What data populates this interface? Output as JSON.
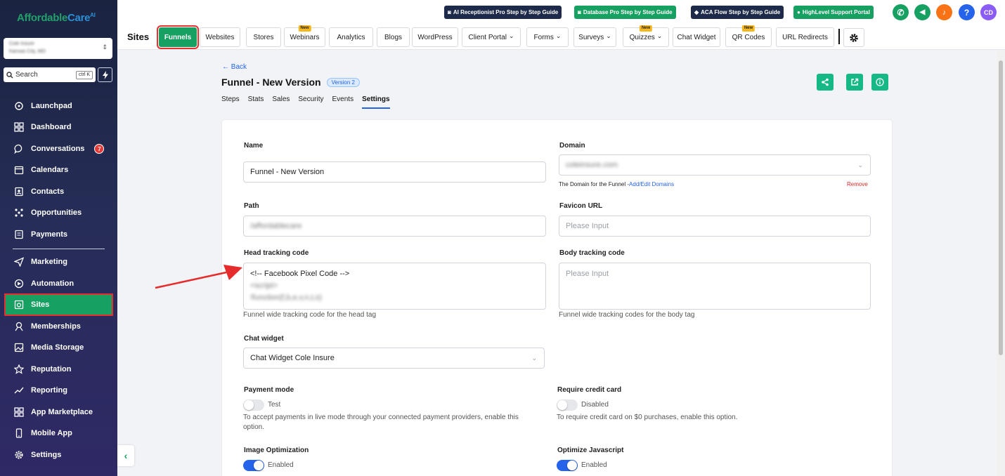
{
  "sidebar": {
    "logo_part1": "Affordable",
    "logo_part2": "Care",
    "logo_part3": "AI",
    "account_name": "Cole Insure",
    "account_location": "Kansas City, MO",
    "search_placeholder": "Search",
    "search_shortcut": "ctrl K",
    "items": [
      {
        "label": "Launchpad",
        "icon": "rocket-icon"
      },
      {
        "label": "Dashboard",
        "icon": "grid-icon"
      },
      {
        "label": "Conversations",
        "icon": "chat-icon",
        "badge": "7"
      },
      {
        "label": "Calendars",
        "icon": "calendar-icon"
      },
      {
        "label": "Contacts",
        "icon": "contacts-icon"
      },
      {
        "label": "Opportunities",
        "icon": "opportunities-icon"
      },
      {
        "label": "Payments",
        "icon": "payments-icon"
      },
      {
        "label": "Marketing",
        "icon": "send-icon"
      },
      {
        "label": "Automation",
        "icon": "automation-icon"
      },
      {
        "label": "Sites",
        "icon": "sites-icon",
        "active": true
      },
      {
        "label": "Memberships",
        "icon": "memberships-icon"
      },
      {
        "label": "Media Storage",
        "icon": "image-icon"
      },
      {
        "label": "Reputation",
        "icon": "star-icon"
      },
      {
        "label": "Reporting",
        "icon": "trend-icon"
      },
      {
        "label": "App Marketplace",
        "icon": "apps-icon"
      },
      {
        "label": "Mobile App",
        "icon": "phone-icon"
      },
      {
        "label": "Settings",
        "icon": "gear-icon"
      }
    ]
  },
  "topbar": {
    "links": [
      "AI Receptionist Pro Step by Step Guide",
      "Database Pro Step by Step Guide",
      "ACA Flow Step by Step Guide",
      "HighLevel Support Portal"
    ],
    "help_label": "?",
    "avatar_initials": "CD"
  },
  "sites_nav": {
    "title": "Sites",
    "tabs": [
      {
        "label": "Funnels",
        "active": true
      },
      {
        "label": "Websites"
      },
      {
        "label": "Stores"
      },
      {
        "label": "Webinars",
        "new": "New"
      },
      {
        "label": "Analytics"
      },
      {
        "label": "Blogs"
      },
      {
        "label": "WordPress"
      },
      {
        "label": "Client Portal",
        "dropdown": true
      },
      {
        "label": "Forms",
        "dropdown": true
      },
      {
        "label": "Surveys",
        "dropdown": true
      },
      {
        "label": "Quizzes",
        "dropdown": true,
        "new": "New"
      },
      {
        "label": "Chat Widget"
      },
      {
        "label": "QR Codes",
        "new": "New"
      },
      {
        "label": "URL Redirects"
      }
    ]
  },
  "funnel": {
    "back_label": "← Back",
    "title": "Funnel - New Version",
    "version_badge": "Version 2",
    "subtabs": [
      "Steps",
      "Stats",
      "Sales",
      "Security",
      "Events",
      "Settings"
    ],
    "active_subtab": "Settings"
  },
  "form": {
    "name_label": "Name",
    "name_value": "Funnel - New Version",
    "domain_label": "Domain",
    "domain_value": "coleinsure.com",
    "domain_hint_text": "The Domain for the Funnel -",
    "domain_hint_link": "Add/Edit Domains",
    "remove_label": "Remove",
    "path_label": "Path",
    "path_value": "/affordablecare",
    "favicon_label": "Favicon URL",
    "favicon_placeholder": "Please Input",
    "head_label": "Head tracking code",
    "head_line1": "<!-- Facebook Pixel Code -->",
    "head_line2": "<script>",
    "head_line3": "!function(f,b,e,v,n,t,s)",
    "head_hint": "Funnel wide tracking code for the head tag",
    "body_label": "Body tracking code",
    "body_placeholder": "Please Input",
    "body_hint": "Funnel wide tracking codes for the body tag",
    "chat_label": "Chat widget",
    "chat_value": "Chat Widget Cole Insure",
    "payment_label": "Payment mode",
    "payment_state": "Test",
    "payment_desc": "To accept payments in live mode through your connected payment providers, enable this option.",
    "cc_label": "Require credit card",
    "cc_state": "Disabled",
    "cc_desc": "To require credit card on $0 purchases, enable this option.",
    "imgopt_label": "Image Optimization",
    "imgopt_state": "Enabled",
    "js_label": "Optimize Javascript",
    "js_state": "Enabled"
  },
  "colors": {
    "accent_green": "#16a061",
    "highlight_red": "#e5302f",
    "link_blue": "#2563eb"
  }
}
